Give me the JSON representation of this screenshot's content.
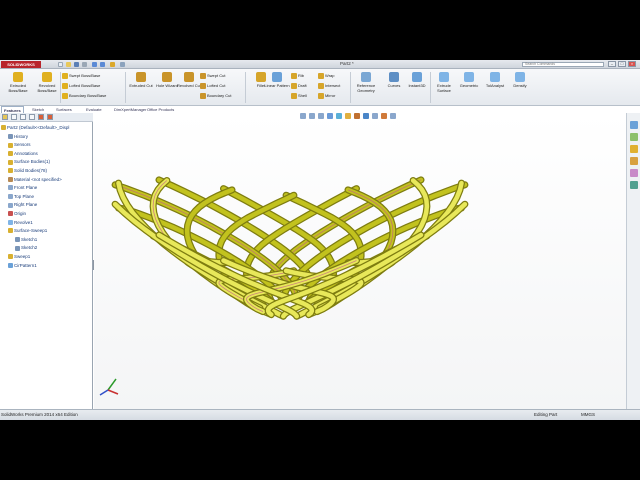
{
  "app": {
    "logo": "SOLIDWORKS",
    "title": "Part2 *",
    "search_placeholder": "Search Commands",
    "window_buttons": [
      "–",
      "□",
      "×"
    ]
  },
  "ribbon": {
    "big": [
      {
        "label": "Extruded Boss/Base",
        "icon": "extrude-icon",
        "color": "#e0b020"
      },
      {
        "label": "Revolved Boss/Base",
        "icon": "revolve-icon",
        "color": "#e0b020"
      },
      {
        "label": "Extruded Cut",
        "icon": "extruded-cut-icon",
        "color": "#c9942a"
      },
      {
        "label": "Hole Wizard",
        "icon": "hole-wizard-icon",
        "color": "#c9942a"
      },
      {
        "label": "Revolved Cut",
        "icon": "revolved-cut-icon",
        "color": "#c9942a"
      },
      {
        "label": "Fillet",
        "icon": "fillet-icon",
        "color": "#d6a52a"
      },
      {
        "label": "Linear Pattern",
        "icon": "linear-pattern-icon",
        "color": "#6aa1d8"
      },
      {
        "label": "Reference Geometry",
        "icon": "reference-geometry-icon",
        "color": "#7aa7d4"
      },
      {
        "label": "Curves",
        "icon": "curves-icon",
        "color": "#5e8fc5"
      },
      {
        "label": "Instant3D",
        "icon": "instant3d-icon",
        "color": "#6aa1d8"
      },
      {
        "label": "Extrude Surface",
        "icon": "extrude-surface-icon",
        "color": "#7fb4e6"
      },
      {
        "label": "Geometric",
        "icon": "geometric-icon",
        "color": "#7fb4e6"
      },
      {
        "label": "TolAnalyst",
        "icon": "tolanalyst-icon",
        "color": "#7fb4e6"
      },
      {
        "label": "Densify",
        "icon": "densify-icon",
        "color": "#7fb4e6"
      }
    ],
    "group1": [
      {
        "label": "Swept Boss/Base",
        "icon": "swept-boss-icon",
        "color": "#e0b020"
      },
      {
        "label": "Lofted Boss/Base",
        "icon": "lofted-boss-icon",
        "color": "#e0b020"
      },
      {
        "label": "Boundary Boss/Base",
        "icon": "boundary-boss-icon",
        "color": "#e0b020"
      }
    ],
    "group2": [
      {
        "label": "Swept Cut",
        "icon": "swept-cut-icon",
        "color": "#c9942a"
      },
      {
        "label": "Lofted Cut",
        "icon": "lofted-cut-icon",
        "color": "#c9942a"
      },
      {
        "label": "Boundary Cut",
        "icon": "boundary-cut-icon",
        "color": "#c9942a"
      }
    ],
    "group3": [
      {
        "label": "Rib",
        "icon": "rib-icon",
        "color": "#d6a52a"
      },
      {
        "label": "Draft",
        "icon": "draft-icon",
        "color": "#d6a52a"
      },
      {
        "label": "Shell",
        "icon": "shell-icon",
        "color": "#d6a52a"
      }
    ],
    "group4": [
      {
        "label": "Wrap",
        "icon": "wrap-icon",
        "color": "#d6a52a"
      },
      {
        "label": "Intersect",
        "icon": "intersect-icon",
        "color": "#d6a52a"
      },
      {
        "label": "Mirror",
        "icon": "mirror-icon",
        "color": "#d6a52a"
      }
    ]
  },
  "tabs": [
    "Features",
    "Sketch",
    "Surfaces",
    "Evaluate",
    "DimXpertManager",
    "Office Products"
  ],
  "tree": [
    {
      "label": "Part2 (Default<<Default>_Displ",
      "icon": "part-icon",
      "color": "#d8b030",
      "indent": 0
    },
    {
      "label": "History",
      "icon": "history-icon",
      "color": "#7a95b8",
      "indent": 1
    },
    {
      "label": "Sensors",
      "icon": "sensors-icon",
      "color": "#d8b030",
      "indent": 1
    },
    {
      "label": "Annotations",
      "icon": "annotations-icon",
      "color": "#d8b030",
      "indent": 1
    },
    {
      "label": "Surface Bodies(1)",
      "icon": "surface-bodies-icon",
      "color": "#d8b030",
      "indent": 1
    },
    {
      "label": "Solid Bodies(78)",
      "icon": "solid-bodies-icon",
      "color": "#d8b030",
      "indent": 1
    },
    {
      "label": "Material <not specified>",
      "icon": "material-icon",
      "color": "#b78a54",
      "indent": 1
    },
    {
      "label": "Front Plane",
      "icon": "plane-icon",
      "color": "#8aa7cc",
      "indent": 1
    },
    {
      "label": "Top Plane",
      "icon": "plane-icon",
      "color": "#8aa7cc",
      "indent": 1
    },
    {
      "label": "Right Plane",
      "icon": "plane-icon",
      "color": "#8aa7cc",
      "indent": 1
    },
    {
      "label": "Origin",
      "icon": "origin-icon",
      "color": "#c85050",
      "indent": 1
    },
    {
      "label": "Revolve1",
      "icon": "revolve-feature-icon",
      "color": "#7fb4e6",
      "indent": 1
    },
    {
      "label": "Surface-Sweep1",
      "icon": "sweep-feature-icon",
      "color": "#d8b030",
      "indent": 1
    },
    {
      "label": "Sketch1",
      "icon": "sketch-icon",
      "color": "#7a95b8",
      "indent": 2
    },
    {
      "label": "Sketch2",
      "icon": "sketch-icon",
      "color": "#7a95b8",
      "indent": 2
    },
    {
      "label": "Sweep1",
      "icon": "sweep-feature-icon",
      "color": "#d8b030",
      "indent": 1
    },
    {
      "label": "CirPattern1",
      "icon": "circular-pattern-icon",
      "color": "#6aa1d8",
      "indent": 1
    }
  ],
  "status": {
    "left": "SolidWorks Premium 2014 x64 Edition",
    "mode": "Editing Part",
    "units": "MMGS"
  },
  "colors": {
    "model": "#c2c21e",
    "model_dark": "#7e7d10",
    "model_light": "#e8e85a",
    "edge_highlight": "#c05a8c"
  }
}
